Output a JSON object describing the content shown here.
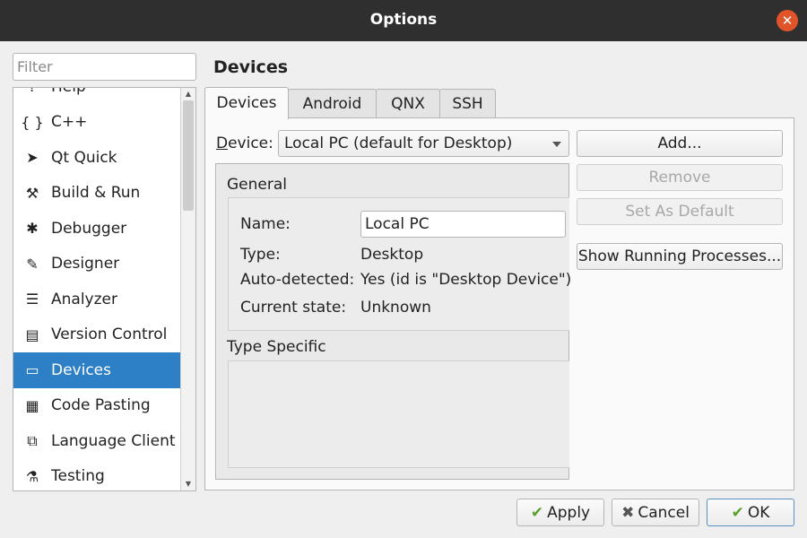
{
  "window": {
    "title": "Options"
  },
  "filter": {
    "placeholder": "Filter"
  },
  "sidebar": {
    "items": [
      {
        "label": "Help",
        "icon": "help-icon",
        "glyph": "?"
      },
      {
        "label": "C++",
        "icon": "braces-icon",
        "glyph": "{ }"
      },
      {
        "label": "Qt Quick",
        "icon": "paper-plane-icon",
        "glyph": "➤"
      },
      {
        "label": "Build & Run",
        "icon": "hammer-icon",
        "glyph": "⚒"
      },
      {
        "label": "Debugger",
        "icon": "bug-icon",
        "glyph": "✱"
      },
      {
        "label": "Designer",
        "icon": "pencil-icon",
        "glyph": "✎"
      },
      {
        "label": "Analyzer",
        "icon": "analyzer-icon",
        "glyph": "☰"
      },
      {
        "label": "Version Control",
        "icon": "document-icon",
        "glyph": "▤"
      },
      {
        "label": "Devices",
        "icon": "monitor-icon",
        "glyph": "▭",
        "selected": true
      },
      {
        "label": "Code Pasting",
        "icon": "clipboard-icon",
        "glyph": "▦"
      },
      {
        "label": "Language Client",
        "icon": "plugin-icon",
        "glyph": "⧉"
      },
      {
        "label": "Testing",
        "icon": "flask-icon",
        "glyph": "⚗"
      }
    ]
  },
  "main": {
    "title": "Devices",
    "tabs": [
      "Devices",
      "Android",
      "QNX",
      "SSH"
    ],
    "active_tab": "Devices",
    "device_label": "Device:",
    "device_selected": "Local PC (default for Desktop)",
    "buttons": {
      "add": "Add...",
      "remove": "Remove",
      "set_default": "Set As Default",
      "show_processes": "Show Running Processes..."
    },
    "general": {
      "title": "General",
      "name_label": "Name:",
      "name_value": "Local PC",
      "type_label": "Type:",
      "type_value": "Desktop",
      "auto_label": "Auto-detected:",
      "auto_value": "Yes (id is \"Desktop Device\")",
      "state_label": "Current state:",
      "state_value": "Unknown"
    },
    "type_specific": {
      "title": "Type Specific"
    }
  },
  "footer": {
    "apply": "Apply",
    "cancel": "Cancel",
    "ok": "OK"
  },
  "colors": {
    "titlebar": "#2f2f2f",
    "close": "#e0542a",
    "selection": "#2d7fc6",
    "check": "#5aa02c"
  }
}
